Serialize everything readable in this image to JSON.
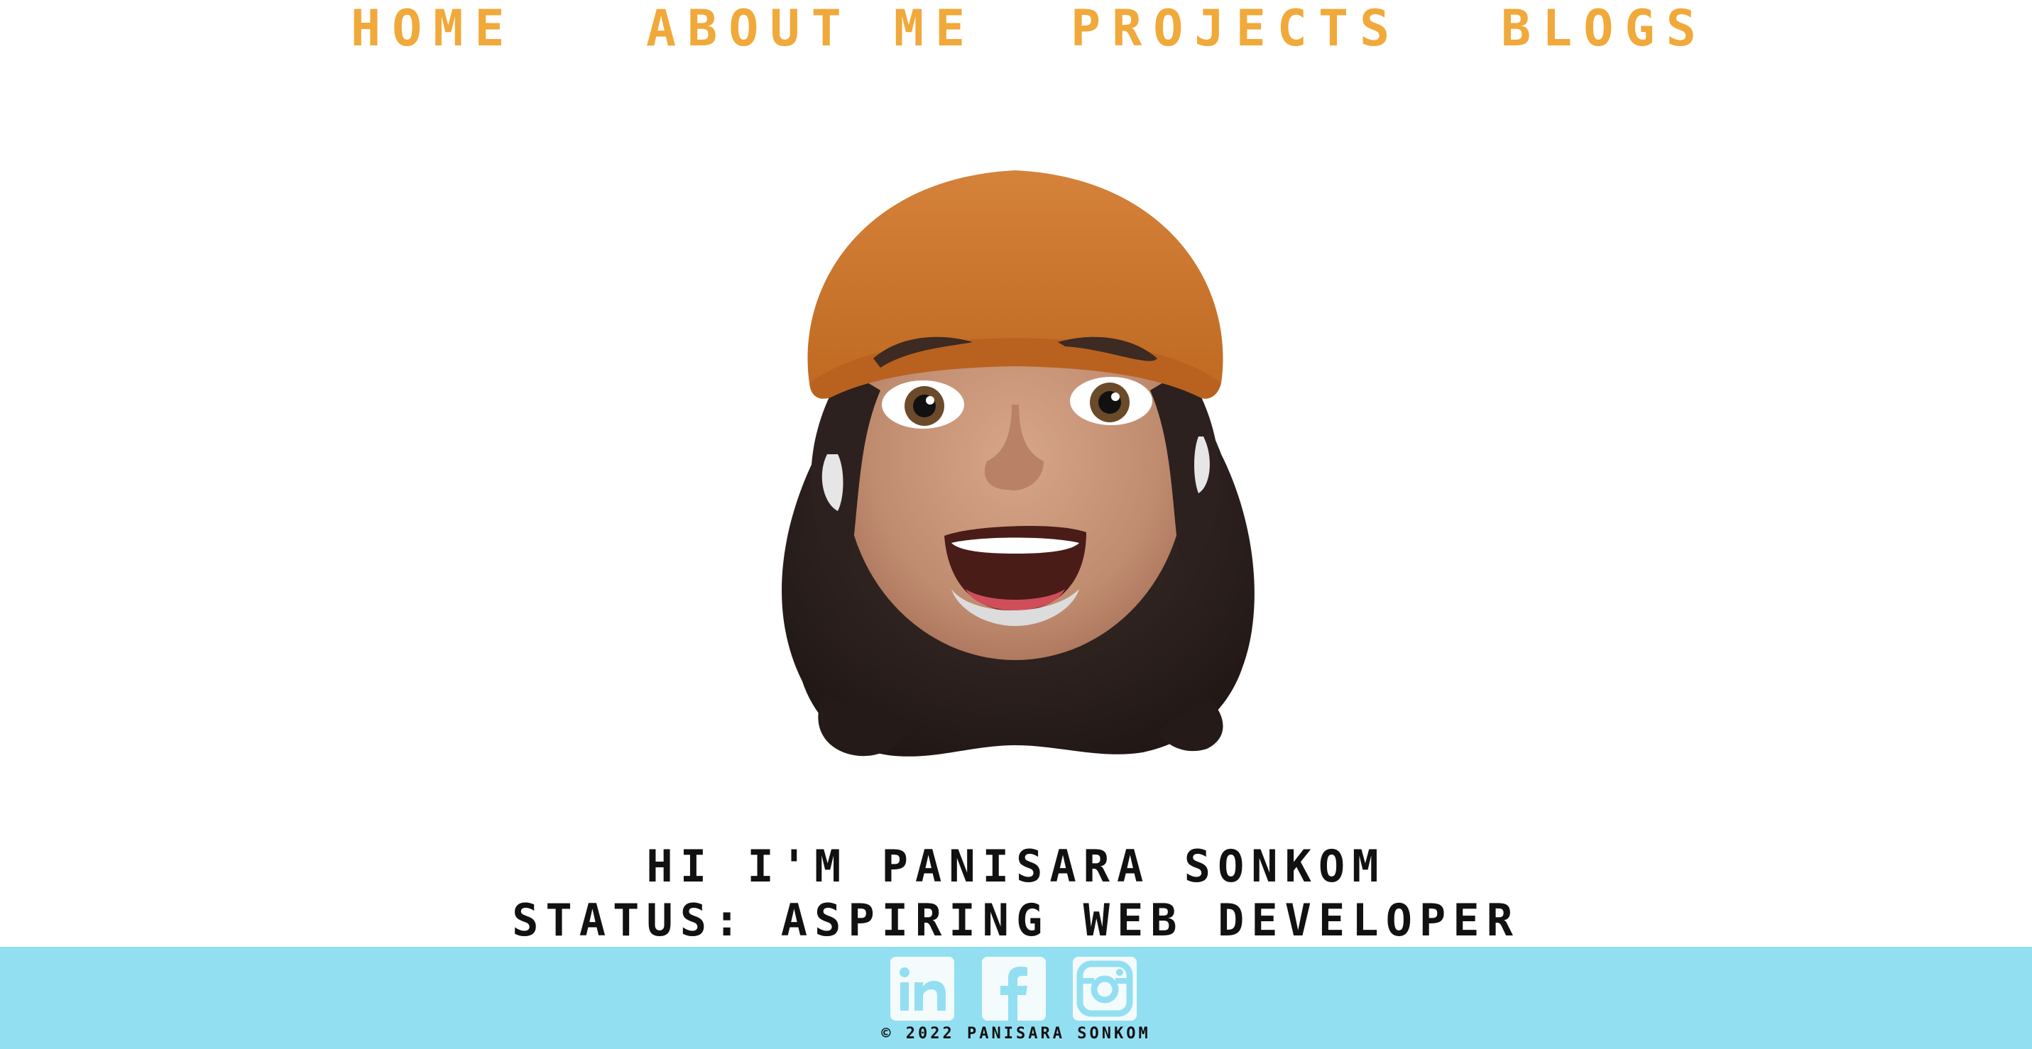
{
  "nav": {
    "items": [
      {
        "label": "HOME"
      },
      {
        "label": "ABOUT ME"
      },
      {
        "label": "PROJECTS"
      },
      {
        "label": "BLOGS"
      }
    ]
  },
  "hero": {
    "avatar_icon": "memoji-avatar-orange-beanie",
    "greeting": "HI I'M PANISARA SONKOM",
    "status": "STATUS: ASPIRING WEB DEVELOPER"
  },
  "footer": {
    "social": [
      {
        "icon": "linkedin-icon"
      },
      {
        "icon": "facebook-icon"
      },
      {
        "icon": "instagram-icon"
      }
    ],
    "copyright": "© 2022 PANISARA SONKOM"
  },
  "colors": {
    "nav_text": "#f0a93a",
    "footer_bg": "#93dff2",
    "text": "#111111",
    "background": "#ffffff"
  }
}
